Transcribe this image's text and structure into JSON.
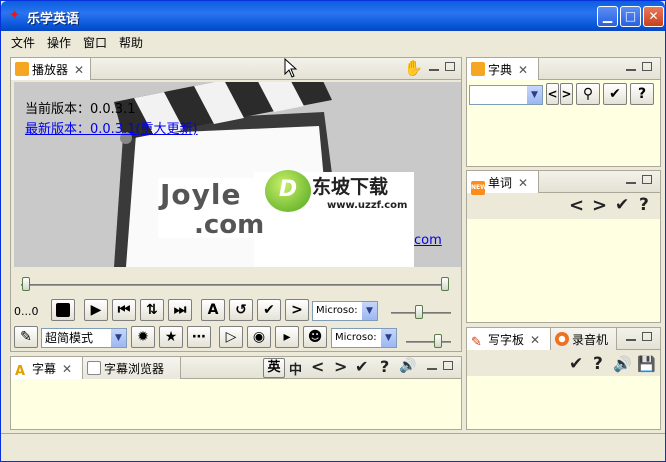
{
  "window": {
    "title": "乐学英语",
    "minimize": "▁",
    "maximize": "□",
    "close": "✕"
  },
  "menu": [
    "文件",
    "操作",
    "窗口",
    "帮助"
  ],
  "player": {
    "tab_label": "播放器",
    "version_current": "当前版本：0.0.3.1",
    "version_latest": "最新版本：0.0.3.1(重大更新)",
    "logo_text_1": "Joyle",
    "logo_text_2": ".com",
    "link_fragment": "com",
    "watermark_cn": "东坡下载",
    "watermark_url": "www.uzzf.com",
    "watermark_letter": "D",
    "time": "0...0",
    "font_combo_1": "Microso:",
    "font_combo_2": "Microso:",
    "mode_combo": "超简模式",
    "btn_a": "A"
  },
  "dict": {
    "tab_label": "字典"
  },
  "words": {
    "tab_label": "单词",
    "new_badge": "NEW"
  },
  "writing": {
    "tab_label": "写字板",
    "recorder_label": "录音机"
  },
  "subtitle": {
    "tab_label": "字幕",
    "browser_label": "字幕浏览器",
    "en": "英",
    "zh": "中"
  },
  "glyphs": {
    "prev": "<",
    "next": ">",
    "check": "✔",
    "help": "?",
    "speaker": "🔊",
    "save": "💾",
    "close_x": "✕"
  }
}
